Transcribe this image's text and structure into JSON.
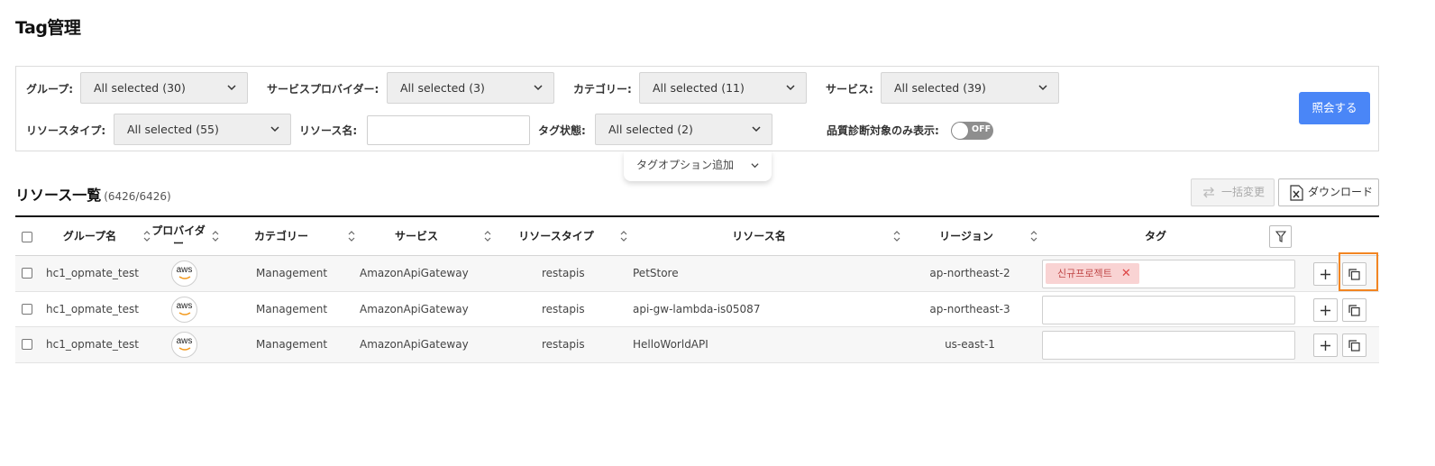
{
  "page": {
    "title": "Tag管理"
  },
  "filters": {
    "group": {
      "label": "グループ:",
      "value": "All selected (30)"
    },
    "provider": {
      "label": "サービスプロバイダー:",
      "value": "All selected (3)"
    },
    "category": {
      "label": "カテゴリー:",
      "value": "All selected (11)"
    },
    "service": {
      "label": "サービス:",
      "value": "All selected (39)"
    },
    "resource_type": {
      "label": "リソースタイプ:",
      "value": "All selected (55)"
    },
    "resource_name": {
      "label": "リソース名:",
      "value": ""
    },
    "tag_status": {
      "label": "タグ状態:",
      "value": "All selected (2)"
    },
    "quality_only": {
      "label": "品質診断対象のみ表示:",
      "state": "OFF"
    },
    "search_button": "照会する",
    "tag_option": "タグオプション追加"
  },
  "list": {
    "title": "リソース一覧",
    "count": "(6426/6426)",
    "bulk_change": "一括変更",
    "download": "ダウンロード",
    "columns": {
      "group": "グループ名",
      "provider": "プロバイダー",
      "category": "カテゴリー",
      "service": "サービス",
      "resource_type": "リソースタイプ",
      "resource_name": "リソース名",
      "region": "リージョン",
      "tag": "タグ"
    },
    "rows": [
      {
        "group": "hc1_opmate_test",
        "provider": "aws",
        "category": "Management",
        "service": "AmazonApiGateway",
        "resource_type": "restapis",
        "resource_name": "PetStore",
        "region": "ap-northeast-2",
        "tag": "신규프로젝트"
      },
      {
        "group": "hc1_opmate_test",
        "provider": "aws",
        "category": "Management",
        "service": "AmazonApiGateway",
        "resource_type": "restapis",
        "resource_name": "api-gw-lambda-is05087",
        "region": "ap-northeast-3",
        "tag": ""
      },
      {
        "group": "hc1_opmate_test",
        "provider": "aws",
        "category": "Management",
        "service": "AmazonApiGateway",
        "resource_type": "restapis",
        "resource_name": "HelloWorldAPI",
        "region": "us-east-1",
        "tag": ""
      }
    ]
  },
  "colors": {
    "primary": "#4a86f7",
    "highlight": "#f28522",
    "tag_bg": "#f9d3d3",
    "tag_text": "#c04848"
  },
  "icons": [
    "chevron-down-icon",
    "sort-icon",
    "filter-icon",
    "plus-icon",
    "copy-icon",
    "close-icon",
    "excel-icon",
    "swap-icon",
    "aws-logo"
  ]
}
